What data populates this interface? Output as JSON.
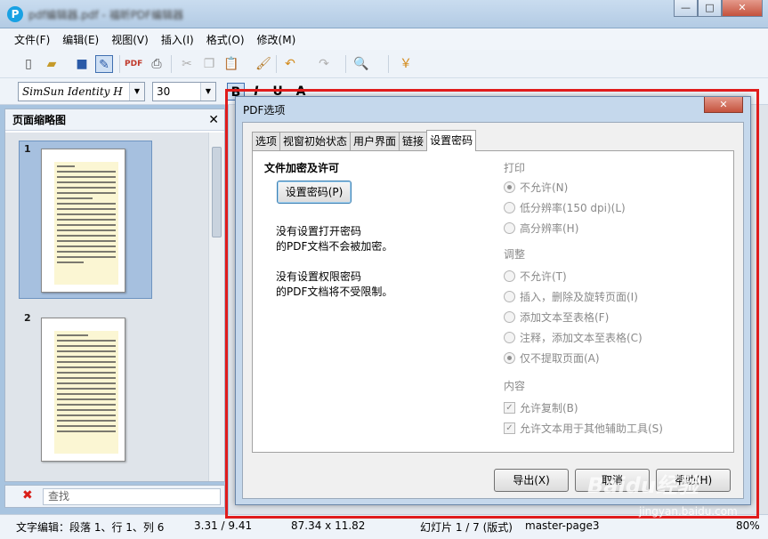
{
  "window": {
    "title_blurred": "pdf编辑器.pdf - 福昕PDF编辑器",
    "logo_glyph": "P",
    "minimize": "—",
    "maximize": "□",
    "close": "✕"
  },
  "menu": [
    "文件(F)",
    "编辑(E)",
    "视图(V)",
    "插入(I)",
    "格式(O)",
    "修改(M)"
  ],
  "toolbar2": {
    "font": "SimSun Identity H",
    "size": "30",
    "bold": "B",
    "italic": "I",
    "underline": "U",
    "text_color": "A"
  },
  "left_panel": {
    "title": "页面缩略图",
    "close": "✕",
    "pages": [
      {
        "num": "1"
      },
      {
        "num": "2"
      }
    ]
  },
  "search": {
    "placeholder": "查找",
    "clear_icon": "✖"
  },
  "status": {
    "edit_mode": "文字编辑：段落 1、行 1、列 6",
    "position": "3.31 / 9.41",
    "size": "87.34 x 11.82",
    "slide": "幻灯片 1 / 7 (版式)",
    "master": "master-page3",
    "zoom": "80%"
  },
  "dialog": {
    "title": "PDF选项",
    "close": "✕",
    "tabs": [
      "选项",
      "视窗初始状态",
      "用户界面",
      "链接",
      "设置密码"
    ],
    "active_tab": 4,
    "encrypt_title": "文件加密及许可",
    "set_password_btn": "设置密码(P)",
    "open_pwd_info_1": "没有设置打开密码",
    "open_pwd_info_2": "的PDF文档不会被加密。",
    "perm_pwd_info_1": "没有设置权限密码",
    "perm_pwd_info_2": "的PDF文档将不受限制。",
    "print_label": "打印",
    "print_options": [
      {
        "label": "不允许(N)",
        "checked": true
      },
      {
        "label": "低分辨率(150 dpi)(L)",
        "checked": false
      },
      {
        "label": "高分辨率(H)",
        "checked": false
      }
    ],
    "adjust_label": "调整",
    "adjust_options": [
      {
        "label": "不允许(T)",
        "checked": false
      },
      {
        "label": "插入，删除及旋转页面(I)",
        "checked": false
      },
      {
        "label": "添加文本至表格(F)",
        "checked": false
      },
      {
        "label": "注释，添加文本至表格(C)",
        "checked": false
      },
      {
        "label": "仅不提取页面(A)",
        "checked": true
      }
    ],
    "content_label": "内容",
    "content_options": [
      {
        "label": "允许复制(B)",
        "checked": true
      },
      {
        "label": "允许文本用于其他辅助工具(S)",
        "checked": true
      }
    ],
    "export_btn": "导出(X)",
    "cancel_btn": "取消",
    "help_btn": "帮助(H)"
  },
  "watermark": {
    "brand": "Baidu经验",
    "url": "jingyan.baidu.com"
  },
  "colors": {
    "highlight_frame": "#e01c1c",
    "dialog_frame": "#c5d8ec",
    "selected_thumb": "#a6c0df"
  }
}
